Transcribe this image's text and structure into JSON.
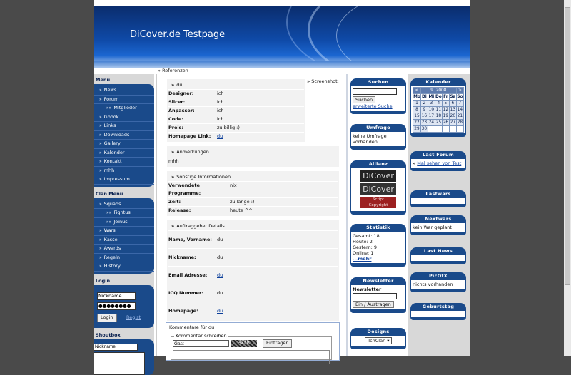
{
  "site": {
    "title": "DiCover.de Testpage"
  },
  "breadcrumb": {
    "marker": "»",
    "label": "Referenzen"
  },
  "menu": {
    "title": "Menü",
    "items": [
      {
        "label": "News",
        "sub": false
      },
      {
        "label": "Forum",
        "sub": false
      },
      {
        "label": "Mitglieder",
        "sub": true
      },
      {
        "label": "Gbook",
        "sub": false
      },
      {
        "label": "Links",
        "sub": false
      },
      {
        "label": "Downloads",
        "sub": false
      },
      {
        "label": "Gallery",
        "sub": false
      },
      {
        "label": "Kalender",
        "sub": false
      },
      {
        "label": "Kontakt",
        "sub": false
      },
      {
        "label": "mhh",
        "sub": false
      },
      {
        "label": "Impressum",
        "sub": false
      }
    ]
  },
  "clan_menu": {
    "title": "Clan Menü",
    "items": [
      {
        "label": "Squads",
        "sub": false
      },
      {
        "label": "Fightus",
        "sub": true
      },
      {
        "label": "Joinus",
        "sub": true
      },
      {
        "label": "Wars",
        "sub": false
      },
      {
        "label": "Kasse",
        "sub": false
      },
      {
        "label": "Awards",
        "sub": false
      },
      {
        "label": "Regeln",
        "sub": false
      },
      {
        "label": "History",
        "sub": false
      }
    ]
  },
  "login": {
    "title": "Login",
    "name_value": "Nickname",
    "password_value": "●●●●●●●●",
    "submit_label": "Login",
    "register_label": "Regist"
  },
  "shoutbox": {
    "title": "Shoutbox",
    "name_value": "Nickname"
  },
  "details": {
    "title": "du",
    "rows": [
      {
        "k": "Designer:",
        "v": "ich"
      },
      {
        "k": "Slicer:",
        "v": "ich"
      },
      {
        "k": "Anpasser:",
        "v": "ich"
      },
      {
        "k": "Code:",
        "v": "ich"
      },
      {
        "k": "Preis:",
        "v": "zu billig :)"
      }
    ],
    "homepage": {
      "k": "Homepage Link:",
      "v": "du"
    },
    "screenshot_label": "Screenshot:"
  },
  "notes": {
    "title": "Anmerkungen",
    "text": "mhh"
  },
  "other": {
    "title": "Sonstige Informationen",
    "rows": [
      {
        "k": "Verwendete Programme:",
        "v": "nix"
      },
      {
        "k": "Zeit:",
        "v": "zu lange :)"
      },
      {
        "k": "Release:",
        "v": "heute ^^"
      }
    ]
  },
  "client": {
    "title": "Auftraggeber Details",
    "rows": [
      {
        "k": "Name, Vorname:",
        "v": "du",
        "link": false
      },
      {
        "k": "Nickname:",
        "v": "du",
        "link": false
      },
      {
        "k": "Email Adresse:",
        "v": "du",
        "link": true
      },
      {
        "k": "ICQ Nummer:",
        "v": "du",
        "link": false
      },
      {
        "k": "Homepage:",
        "v": "du",
        "link": true
      }
    ]
  },
  "comments": {
    "title": "Kommentare für du",
    "legend": "Kommentar schreiben",
    "guest_value": "Gast",
    "captcha": "4ZFR",
    "submit_label": "Eintragen"
  },
  "search": {
    "title": "Suchen",
    "button": "Suchen",
    "advanced": "erweiterte Suche"
  },
  "poll": {
    "title": "Umfrage",
    "text": "keine Umfrage vorhanden"
  },
  "alliance": {
    "title": "Allianz",
    "logo1": "DiCover",
    "logo2": "DiCover",
    "logo3_line1": "Script",
    "logo3_line2": "Copyright"
  },
  "stats": {
    "title": "Statistik",
    "lines": [
      "Gesamt: 18",
      "Heute: 2",
      "Gestern: 9",
      "Online: 1"
    ],
    "more": "...mehr"
  },
  "newsletter": {
    "title": "Newsletter",
    "label": "Newsletter",
    "button": "Ein / Austragen"
  },
  "designs": {
    "title": "Designs",
    "selected": "ilchClan"
  },
  "calendar": {
    "title": "Kalender",
    "month_label": "9. 2008",
    "prev": "<",
    "next": ">",
    "weekdays": [
      "Mo",
      "Di",
      "Mi",
      "Do",
      "Fr",
      "Sa",
      "So"
    ],
    "weeks": [
      [
        "1",
        "2",
        "3",
        "4",
        "5",
        "6",
        "7"
      ],
      [
        "8",
        "9",
        "10",
        "11",
        "12",
        "13",
        "14"
      ],
      [
        "15",
        "16",
        "17",
        "18",
        "19",
        "20",
        "21"
      ],
      [
        "22",
        "23",
        "24",
        "25",
        "26",
        "27",
        "28"
      ],
      [
        "29",
        "30",
        "",
        "",
        "",
        "",
        ""
      ]
    ]
  },
  "last_forum": {
    "title": "Last Forum",
    "item": "Mal sehen von Test"
  },
  "lastwars": {
    "title": "Lastwars"
  },
  "nextwars": {
    "title": "Nextwars",
    "text": "kein War geplant"
  },
  "last_news": {
    "title": "Last News"
  },
  "picofx": {
    "title": "PicOfX",
    "text": "nichts vorhanden"
  },
  "birthday": {
    "title": "Geburtstag"
  }
}
